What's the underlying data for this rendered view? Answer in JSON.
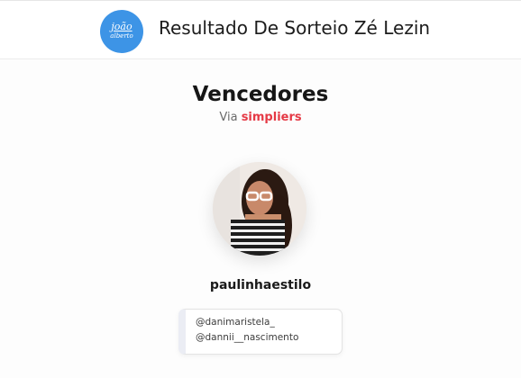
{
  "header": {
    "logo_line1": "joão",
    "logo_line2": "alberto",
    "title": "Resultado De Sorteio Zé Lezin"
  },
  "main": {
    "heading": "Vencedores",
    "via_prefix": "Via",
    "via_brand": "simpliers",
    "winner": {
      "username": "paulinhaestilo",
      "mentions": [
        "@danimaristela_",
        "@dannii__nascimento"
      ]
    }
  },
  "colors": {
    "logo_bg": "#3d94e6",
    "brand_red": "#e53945"
  }
}
